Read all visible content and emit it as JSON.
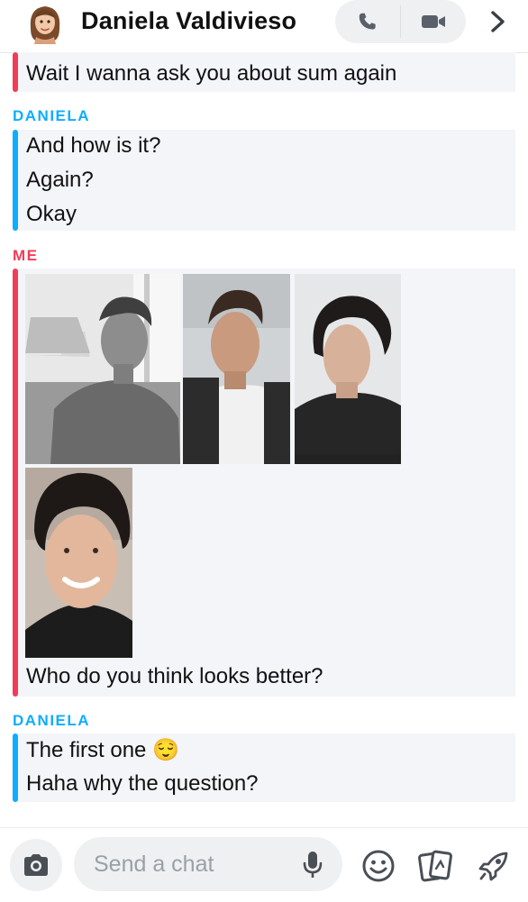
{
  "header": {
    "contact_name": "Daniela Valdivieso",
    "avatar_icon": "bitmoji-avatar-icon",
    "phone_icon": "phone-icon",
    "video_icon": "video-camera-icon",
    "forward_icon": "chevron-right-icon"
  },
  "messages": [
    {
      "sender": "",
      "from": "me",
      "lines": [
        "Wait I wanna ask you about sum again"
      ]
    },
    {
      "sender": "DANIELA",
      "from": "her",
      "lines": [
        "And how is it?",
        "Again?",
        "Okay"
      ]
    },
    {
      "sender": "ME",
      "from": "me",
      "photos": 4,
      "lines": [
        "Who do you think looks better?"
      ]
    },
    {
      "sender": "DANIELA",
      "from": "her",
      "lines": [
        "The first one 😌",
        "Haha why the question?"
      ]
    }
  ],
  "composer": {
    "placeholder": "Send a chat",
    "camera_icon": "camera-icon",
    "mic_icon": "microphone-icon",
    "emoji_icon": "smiley-icon",
    "stickers_icon": "stickers-icon",
    "games_icon": "rocket-icon"
  },
  "colors": {
    "me": "#f23c57",
    "her": "#0eadff",
    "bubble_bg": "#f4f5f8"
  }
}
